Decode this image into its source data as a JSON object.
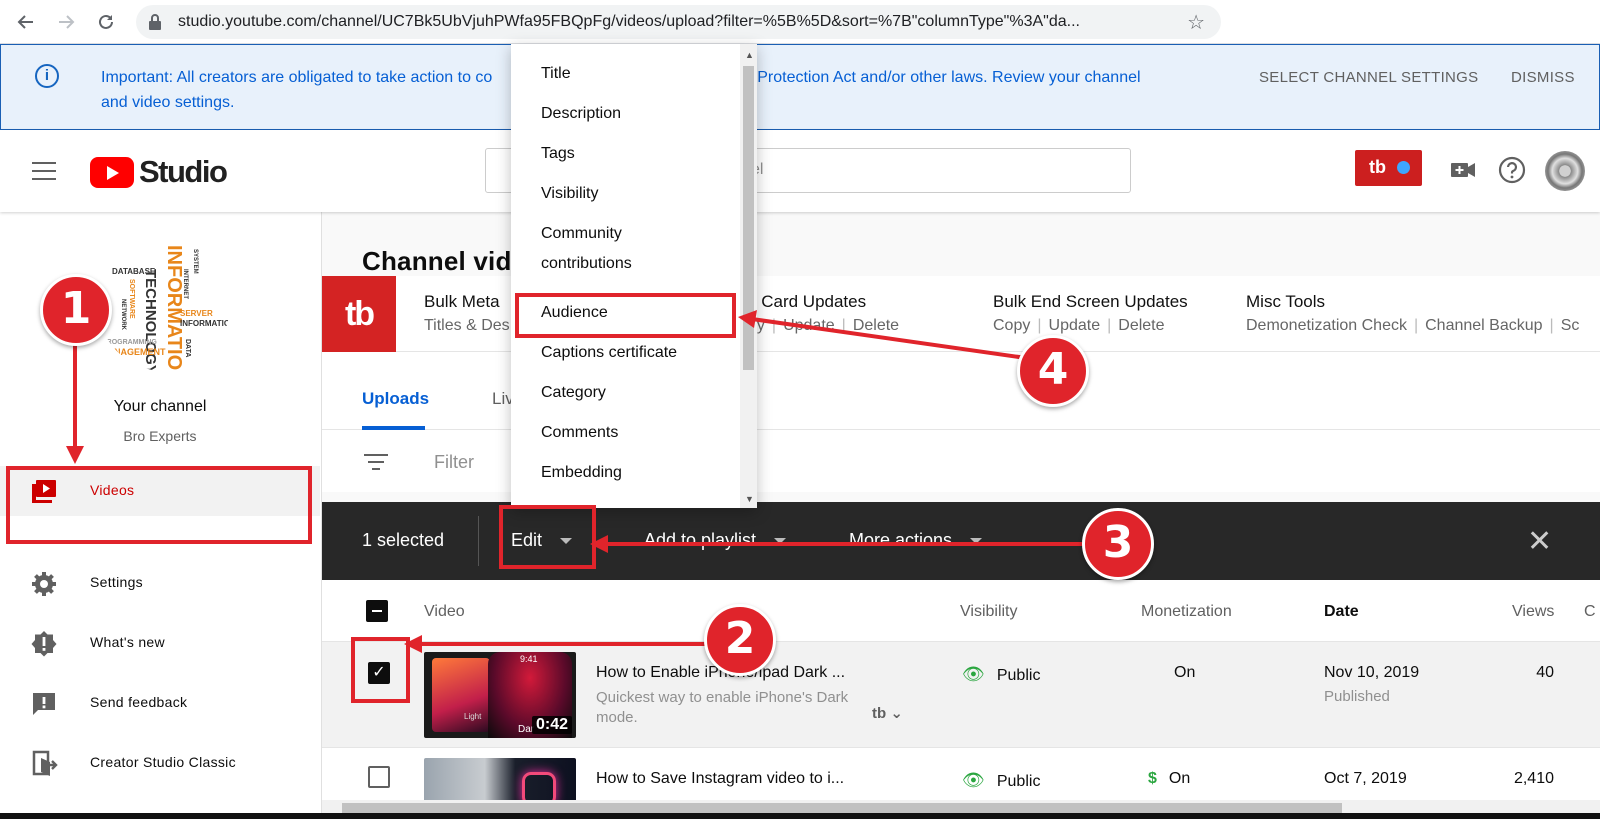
{
  "browser": {
    "url": "studio.youtube.com/channel/UC7Bk5UbVjuhPWfa95FBQpFg/videos/upload?filter=%5B%5D&sort=%7B\"columnType\"%3A\"da..."
  },
  "notice": {
    "message_part1": "Important: All creators are obligated to take action to co",
    "message_part2": "ivacy Protection Act and/or other laws. Review your channel",
    "message_part3": "and video settings.",
    "select_settings": "SELECT CHANNEL SETTINGS",
    "dismiss": "DISMISS"
  },
  "header": {
    "logo_text": "Studio",
    "search_placeholder_fragment": "el",
    "tb_badge": "tb"
  },
  "sidebar": {
    "channel_title": "Your channel",
    "channel_name": "Bro Experts",
    "art_words": [
      "INFORMATION",
      "TECHNOLOGY",
      "DATABASE",
      "SOFTWARE",
      "PROGRAMMING",
      "MANAGEMENT",
      "SERVER",
      "INTERNET",
      "DATA",
      "SYSTEM",
      "NETWORK",
      "INFORMATION"
    ],
    "items": [
      {
        "label": "Videos",
        "icon": "video-icon"
      },
      {
        "label": "Settings",
        "icon": "gear-icon"
      },
      {
        "label": "What's new",
        "icon": "alert-icon"
      },
      {
        "label": "Send feedback",
        "icon": "feedback-icon"
      },
      {
        "label": "Creator Studio Classic",
        "icon": "classic-icon"
      }
    ]
  },
  "main": {
    "page_title": "Channel vid",
    "tubebuddy": {
      "logo": "tb",
      "groups": [
        {
          "heading": "Bulk Meta",
          "links": [
            "Titles & Des"
          ]
        },
        {
          "heading": "k Card Updates",
          "links": [
            "py",
            "Update",
            "Delete"
          ]
        },
        {
          "heading": "Bulk End Screen Updates",
          "links": [
            "Copy",
            "Update",
            "Delete"
          ]
        },
        {
          "heading": "Misc Tools",
          "links": [
            "Demonetization Check",
            "Channel Backup",
            "Sc"
          ]
        }
      ]
    },
    "tabs": [
      "Uploads",
      "Liv"
    ],
    "filter_placeholder": "Filter",
    "action_bar": {
      "selected": "1 selected",
      "edit": "Edit",
      "add_to_playlist": "Add to playlist",
      "more_actions": "More actions"
    },
    "table_headers": {
      "video": "Video",
      "visibility": "Visibility",
      "monetization": "Monetization",
      "date": "Date",
      "views": "Views",
      "c": "C"
    },
    "rows": [
      {
        "title": "How to Enable iPhone/ipad Dark ...",
        "desc": "Quickest way to enable iPhone's Dark mode.",
        "duration": "0:42",
        "visibility": "Public",
        "monetization": "On",
        "date": "Nov 10, 2019",
        "status": "Published",
        "views": "40",
        "thumb_time": "9:41",
        "thumb_light": "Light",
        "thumb_dark": "Dar",
        "tb_tag": "tb"
      },
      {
        "title": "How to Save Instagram video to i...",
        "visibility": "Public",
        "monetization": "On",
        "date": "Oct 7, 2019",
        "views": "2,410"
      }
    ]
  },
  "edit_menu": {
    "items": [
      "Title",
      "Description",
      "Tags",
      "Visibility",
      "Community contributions",
      "Audience",
      "Captions certificate",
      "Category",
      "Comments",
      "Embedding"
    ]
  },
  "annotations": {
    "steps": [
      "1",
      "2",
      "3",
      "4"
    ],
    "color": "#e0242b"
  },
  "colors": {
    "youtube_red": "#ff0000",
    "link_blue": "#065fd4",
    "public_green": "#2ba640",
    "action_bar": "#282828"
  }
}
